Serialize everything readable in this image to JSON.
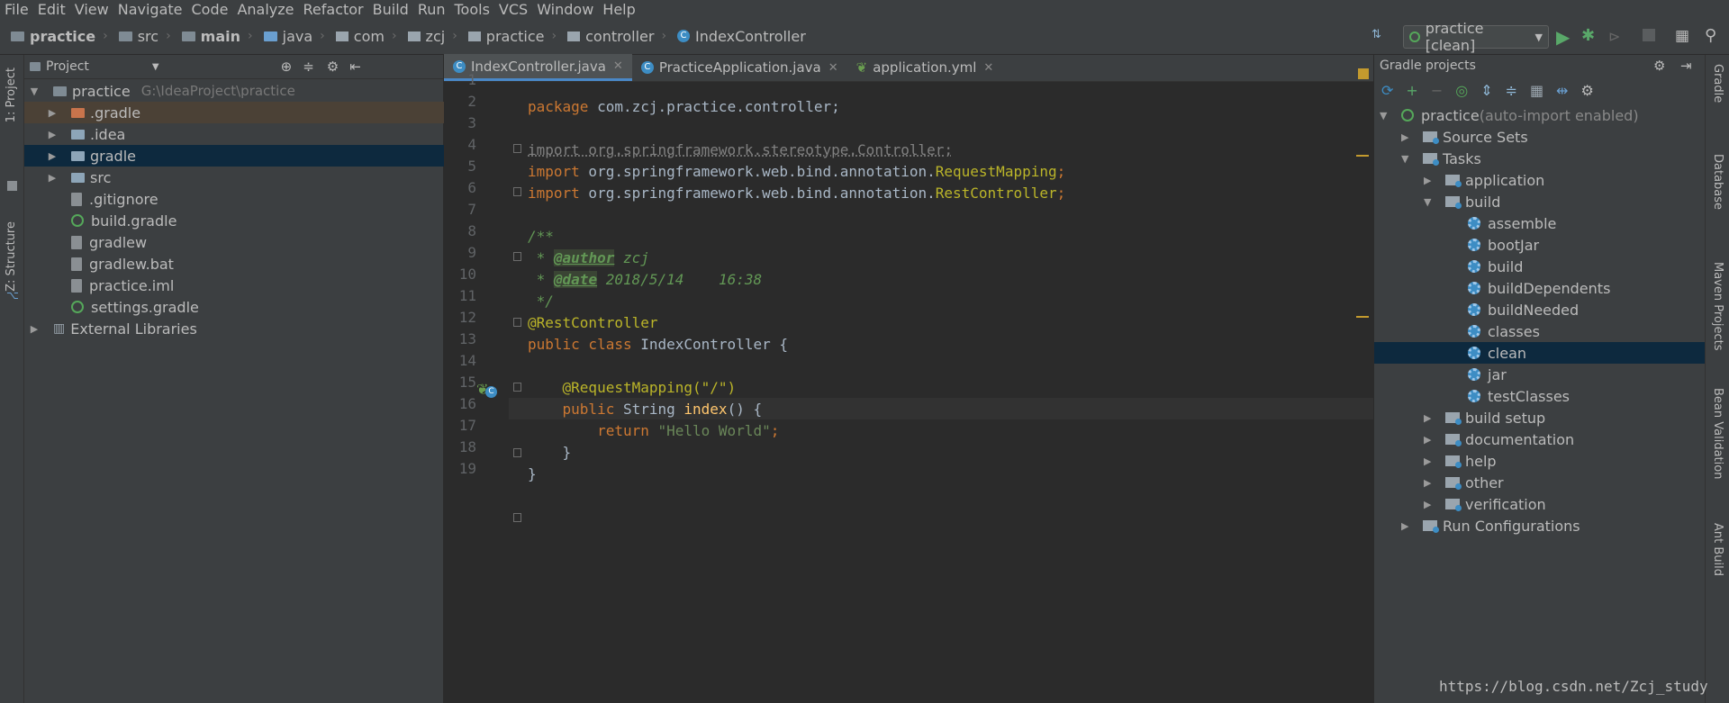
{
  "menu": [
    "File",
    "Edit",
    "View",
    "Navigate",
    "Code",
    "Analyze",
    "Refactor",
    "Build",
    "Run",
    "Tools",
    "VCS",
    "Window",
    "Help"
  ],
  "breadcrumbs": [
    "practice",
    "src",
    "main",
    "java",
    "com",
    "zcj",
    "practice",
    "controller",
    "IndexController"
  ],
  "run_config": "practice [clean]",
  "left_strip": {
    "project": "1: Project",
    "structure": "Z: Structure"
  },
  "project_panel": {
    "title": "Project",
    "root": {
      "name": "practice",
      "path": "G:\\IdeaProject\\practice"
    },
    "items": [
      {
        "label": ".gradle",
        "type": "folder-orange",
        "expandable": true
      },
      {
        "label": ".idea",
        "type": "folder",
        "expandable": true
      },
      {
        "label": "gradle",
        "type": "folder",
        "expandable": true
      },
      {
        "label": "src",
        "type": "folder",
        "expandable": true
      },
      {
        "label": ".gitignore",
        "type": "file",
        "expandable": false
      },
      {
        "label": "build.gradle",
        "type": "gradle",
        "expandable": false
      },
      {
        "label": "gradlew",
        "type": "file",
        "expandable": false
      },
      {
        "label": "gradlew.bat",
        "type": "file",
        "expandable": false
      },
      {
        "label": "practice.iml",
        "type": "file",
        "expandable": false
      },
      {
        "label": "settings.gradle",
        "type": "gradle",
        "expandable": false
      }
    ],
    "external": "External Libraries"
  },
  "tabs": [
    {
      "label": "IndexController.java",
      "active": true
    },
    {
      "label": "PracticeApplication.java",
      "active": false
    },
    {
      "label": "application.yml",
      "active": false
    }
  ],
  "code": {
    "l1_kw": "package",
    "l1_rest": " com.zcj.practice.controller;",
    "l3": "import org.springframework.stereotype.Controller;",
    "l4_a": "import",
    "l4_b": " org.springframework.web.bind.annotation.",
    "l4_c": "RequestMapping",
    "l4_d": ";",
    "l5_a": "import",
    "l5_b": " org.springframework.web.bind.annotation.",
    "l5_c": "RestController",
    "l5_d": ";",
    "l7": "/**",
    "l8_a": " * ",
    "l8_tag": "@author",
    "l8_val": " zcj",
    "l9_a": " * ",
    "l9_tag": "@date",
    "l9_val": " 2018/5/14    16:38",
    "l10": " */",
    "l11": "@RestController",
    "l12_a": "public class",
    "l12_b": " IndexController {",
    "l14": "    @RequestMapping(\"/\")",
    "l15_a": "    public",
    "l15_b": " String ",
    "l15_c": "index",
    "l15_d": "() {",
    "l16_a": "        return",
    "l16_b": " \"Hello World\"",
    "l16_c": ";",
    "l17": "    }",
    "l18": "}"
  },
  "gradle_panel": {
    "title": "Gradle projects",
    "root_name": "practice",
    "root_note": " (auto-import enabled)",
    "source_sets": "Source Sets",
    "tasks": "Tasks",
    "groups": [
      "application",
      "build"
    ],
    "build_tasks": [
      "assemble",
      "bootJar",
      "build",
      "buildDependents",
      "buildNeeded",
      "classes",
      "clean",
      "jar",
      "testClasses"
    ],
    "other_groups": [
      "build setup",
      "documentation",
      "help",
      "other",
      "verification"
    ],
    "run_configs": "Run Configurations"
  },
  "right_strip": [
    "Gradle",
    "Database",
    "Maven Projects",
    "Bean Validation",
    "Ant Build"
  ],
  "watermark": "https://blog.csdn.net/Zcj_study"
}
